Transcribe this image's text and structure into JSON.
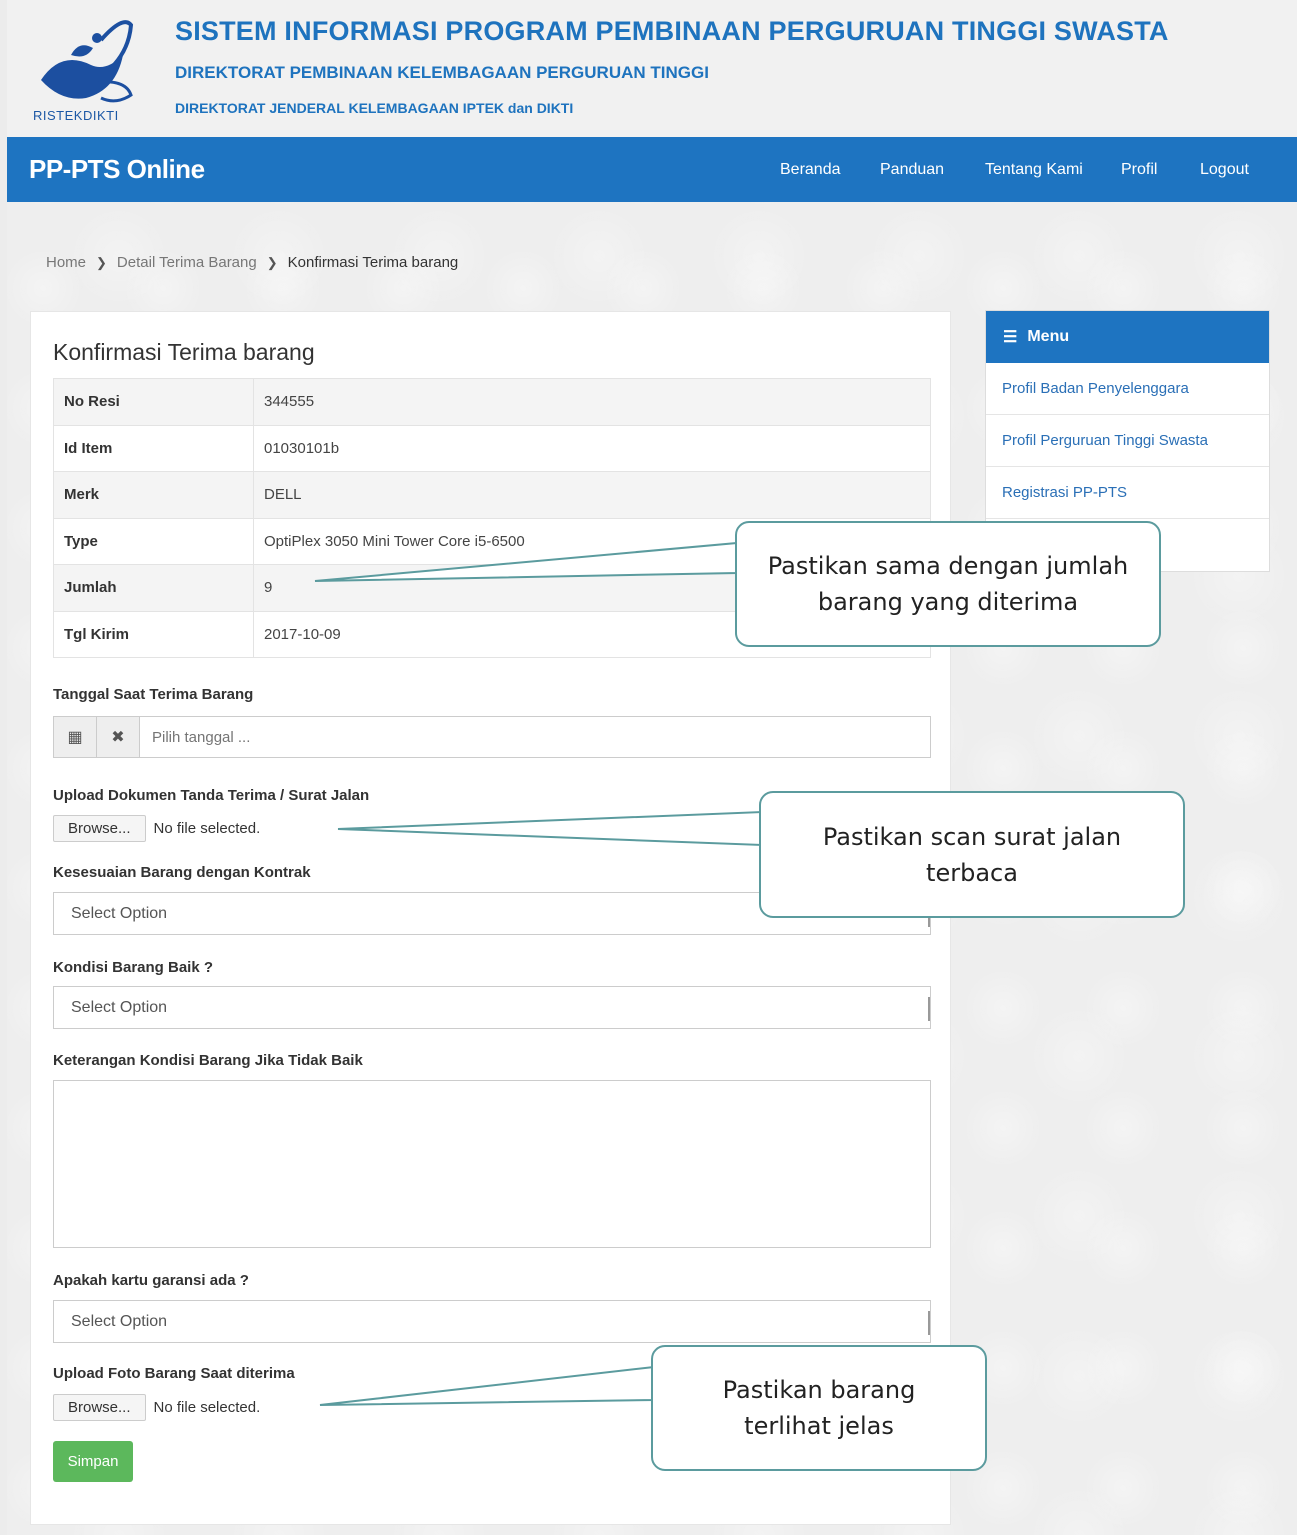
{
  "header": {
    "logo_text": "RISTEKDIKTI",
    "title": "SISTEM INFORMASI PROGRAM PEMBINAAN PERGURUAN TINGGI SWASTA",
    "subtitle1": "DIREKTORAT PEMBINAAN KELEMBAGAAN PERGURUAN TINGGI",
    "subtitle2": "DIREKTORAT JENDERAL KELEMBAGAAN IPTEK dan DIKTI"
  },
  "navbar": {
    "brand": "PP-PTS Online",
    "links": [
      "Beranda",
      "Panduan",
      "Tentang Kami",
      "Profil",
      "Logout"
    ]
  },
  "breadcrumb": [
    "Home",
    "Detail Terima Barang",
    "Konfirmasi Terima barang"
  ],
  "form": {
    "title": "Konfirmasi Terima barang",
    "details": [
      {
        "label": "No Resi",
        "value": "344555"
      },
      {
        "label": "Id Item",
        "value": "01030101b"
      },
      {
        "label": "Merk",
        "value": "DELL"
      },
      {
        "label": "Type",
        "value": "OptiPlex 3050 Mini Tower Core i5-6500"
      },
      {
        "label": "Jumlah",
        "value": "9"
      },
      {
        "label": "Tgl Kirim",
        "value": "2017-10-09"
      }
    ],
    "date_label": "Tanggal Saat Terima Barang",
    "date_placeholder": "Pilih tanggal ...",
    "upload_doc_label": "Upload Dokumen Tanda Terima / Surat Jalan",
    "browse_label": "Browse...",
    "no_file": "No file selected.",
    "kesesuaian_label": "Kesesuaian Barang dengan Kontrak",
    "kondisi_label": "Kondisi Barang Baik ?",
    "keterangan_label": "Keterangan Kondisi Barang Jika Tidak Baik",
    "garansi_label": "Apakah kartu garansi ada ?",
    "select_option": "Select Option",
    "upload_foto_label": "Upload Foto Barang Saat diterima",
    "submit_label": "Simpan"
  },
  "menu": {
    "title": "Menu",
    "items": [
      "Profil Badan Penyelenggara",
      "Profil Perguruan Tinggi Swasta",
      "Registrasi PP-PTS"
    ]
  },
  "callouts": {
    "jumlah": "Pastikan sama dengan jumlah barang yang diterima",
    "surat_jalan": "Pastikan scan surat jalan terbaca",
    "foto": "Pastikan barang terlihat jelas"
  },
  "colors": {
    "primary": "#1e74c1",
    "success": "#5cb85c",
    "callout_border": "#5b9b9e"
  }
}
